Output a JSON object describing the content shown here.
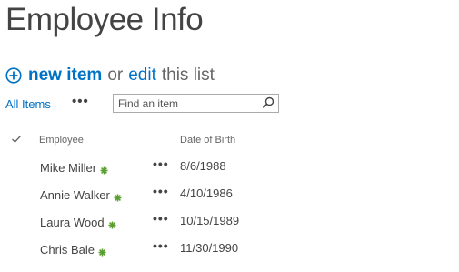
{
  "page": {
    "title": "Employee Info"
  },
  "command_bar": {
    "new_item_label": "new item",
    "or_text": "or",
    "edit_label": "edit",
    "tail_text": "this list"
  },
  "view": {
    "current_view": "All Items",
    "more_label": "•••",
    "search_placeholder": "Find an item"
  },
  "table": {
    "columns": {
      "employee": "Employee",
      "dob": "Date of Birth"
    },
    "row_menu": "•••",
    "rows": [
      {
        "employee": "Mike Miller",
        "dob": "8/6/1988"
      },
      {
        "employee": "Annie Walker",
        "dob": "4/10/1986"
      },
      {
        "employee": "Laura Wood",
        "dob": "10/15/1989"
      },
      {
        "employee": "Chris Bale",
        "dob": "11/30/1990"
      }
    ]
  },
  "colors": {
    "accent": "#0072c6",
    "new_badge": "#5a9e2f",
    "text": "#444444"
  }
}
